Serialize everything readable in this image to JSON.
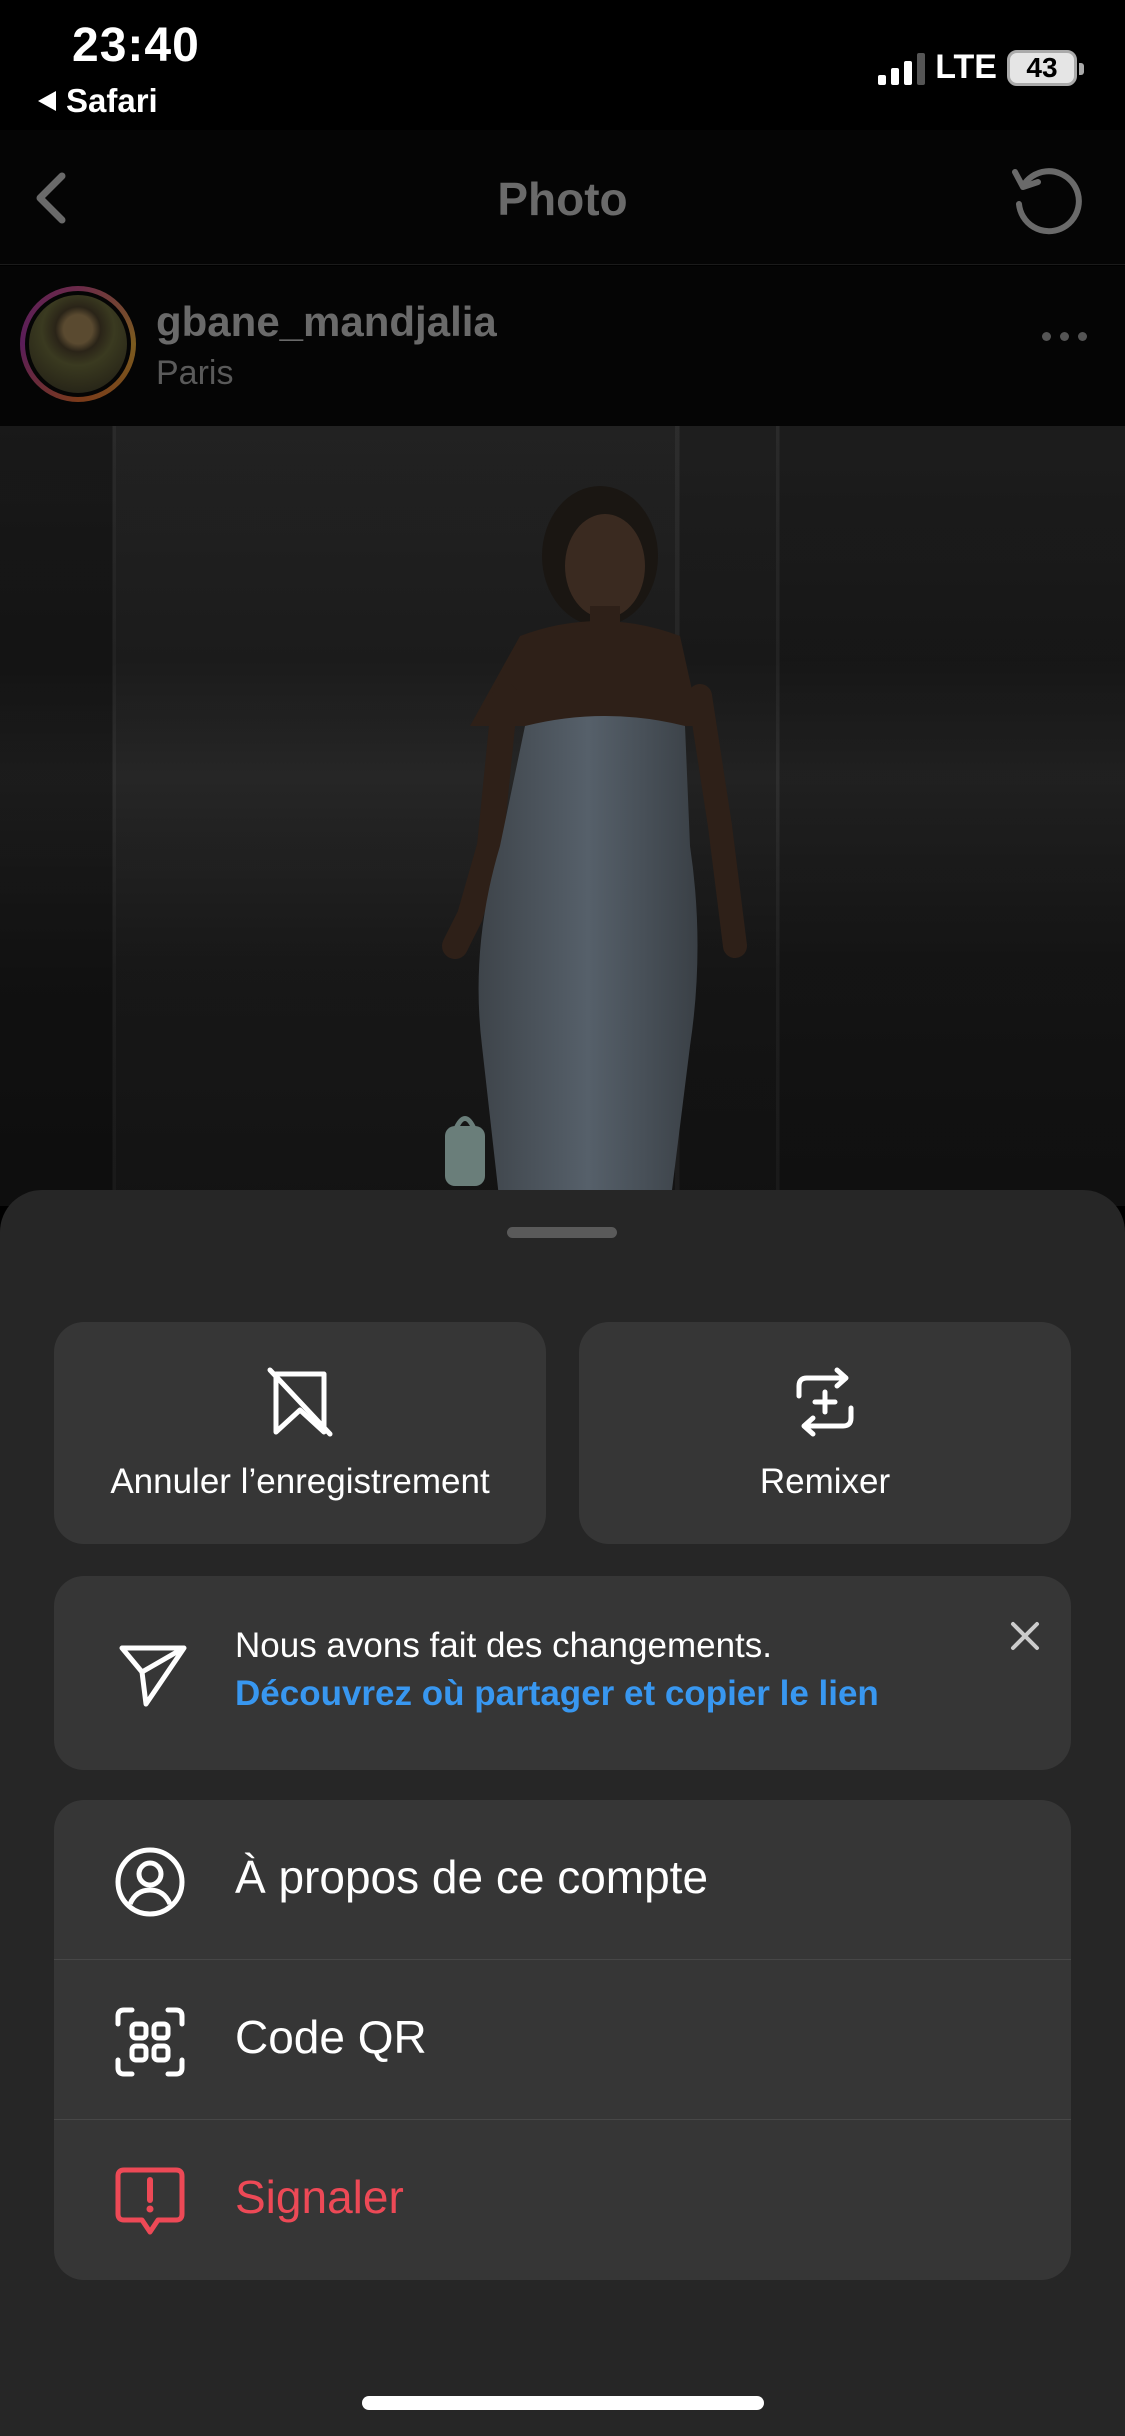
{
  "status_bar": {
    "time": "23:40",
    "back_app": "Safari",
    "network": "LTE",
    "battery": "43"
  },
  "nav": {
    "title": "Photo"
  },
  "post": {
    "username": "gbane_mandjalia",
    "location": "Paris"
  },
  "sheet": {
    "tiles": [
      {
        "label": "Annuler l’enregistrement",
        "icon": "unsave-bookmark-icon"
      },
      {
        "label": "Remixer",
        "icon": "remix-icon"
      }
    ],
    "notice": {
      "text": "Nous avons fait des changements.",
      "link": "Découvrez où partager et copier le lien",
      "icon": "send-icon"
    },
    "menu": [
      {
        "label": "À propos de ce compte",
        "icon": "account-icon"
      },
      {
        "label": "Code QR",
        "icon": "qr-code-icon"
      },
      {
        "label": "Signaler",
        "icon": "report-icon"
      }
    ]
  },
  "colors": {
    "sheet_bg": "#262626",
    "tile_bg": "#363636",
    "link": "#3897f0",
    "danger": "#ed4956"
  }
}
